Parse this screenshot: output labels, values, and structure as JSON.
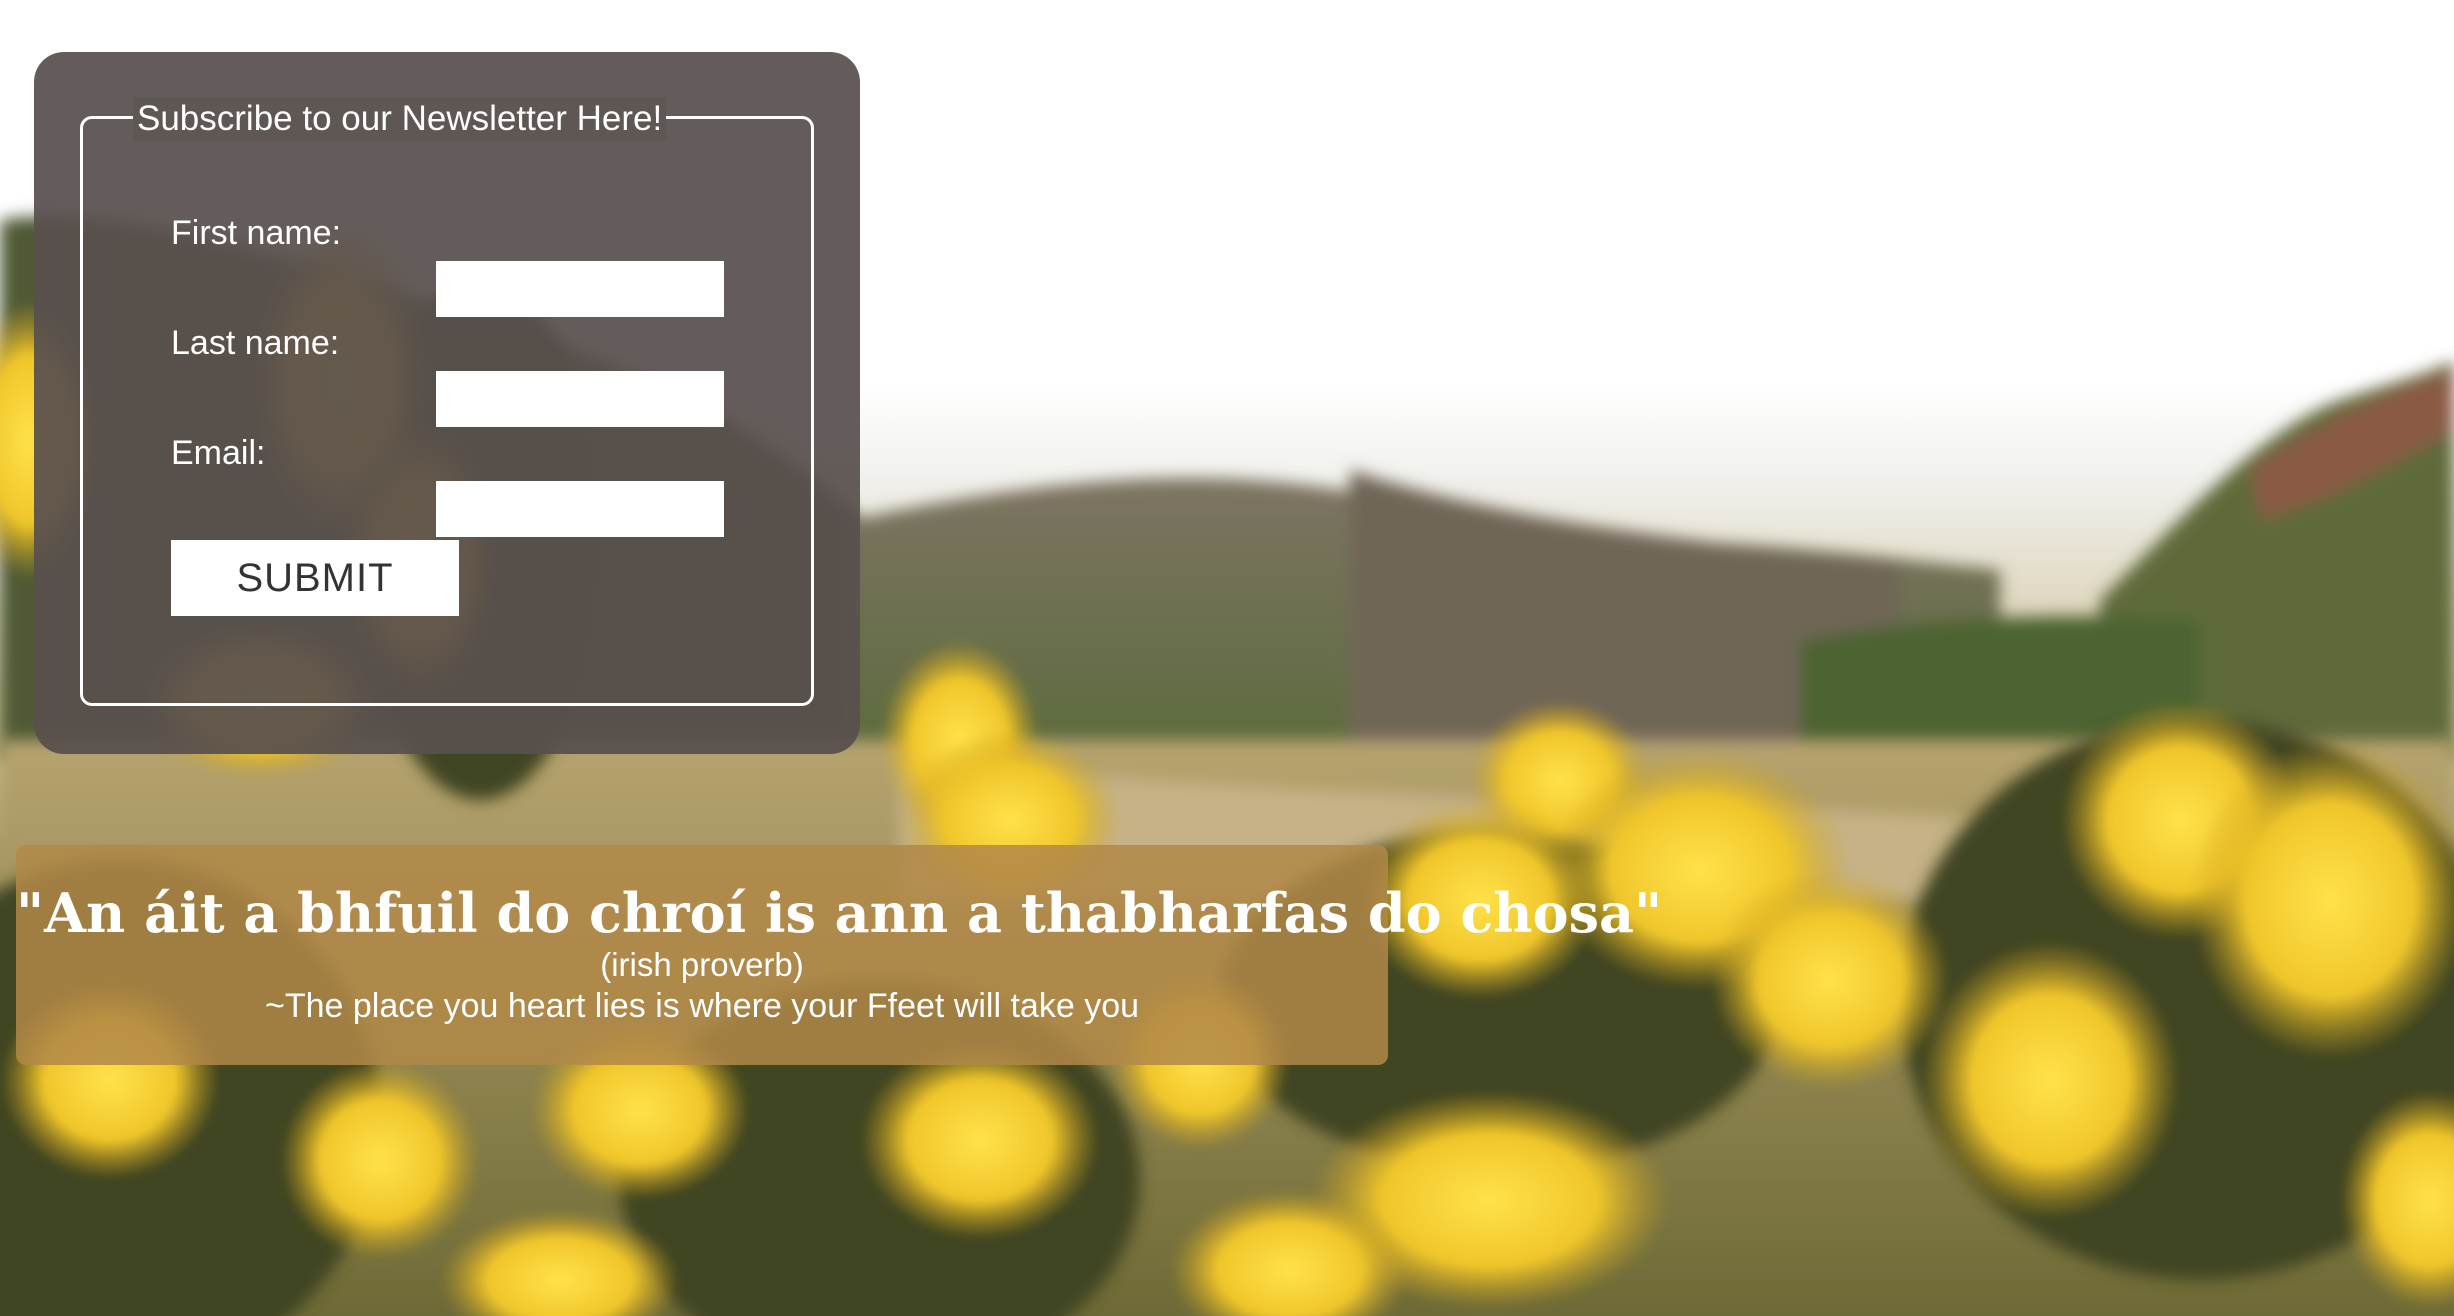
{
  "newsletter": {
    "legend": "Subscribe to our Newsletter Here!",
    "fields": [
      {
        "label": "First name:",
        "value": "",
        "placeholder": ""
      },
      {
        "label": "Last name:",
        "value": "",
        "placeholder": ""
      },
      {
        "label": "Email:",
        "value": "",
        "placeholder": ""
      }
    ],
    "submit_label": "SUBMIT"
  },
  "proverb": {
    "text": "\"An áit a bhfuil do chroí is ann a thabharfas do chosa\"",
    "origin": "(irish proverb)",
    "translation": "~The place you heart lies is where your Ffeet will take you"
  },
  "background": {
    "description_icon": "landscape-photo",
    "sky_color": "#ffffff",
    "flower_color": "#f2cf2a",
    "hill_color": "#5b6a3a"
  }
}
